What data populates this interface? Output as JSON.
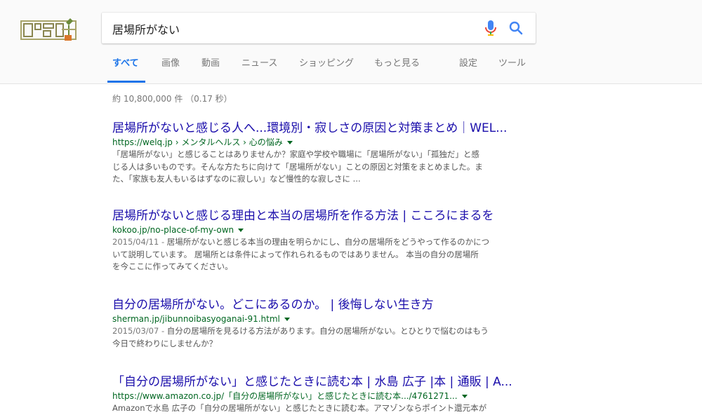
{
  "search": {
    "query": "居場所がない"
  },
  "tabs": [
    {
      "label": "すべて"
    },
    {
      "label": "画像"
    },
    {
      "label": "動画"
    },
    {
      "label": "ニュース"
    },
    {
      "label": "ショッピング"
    },
    {
      "label": "もっと見る"
    },
    {
      "label": "設定"
    },
    {
      "label": "ツール"
    }
  ],
  "stats": "約 10,800,000 件 （0.17 秒）",
  "colors": {
    "link": "#1a0dab",
    "url": "#006621",
    "accent": "#1a73e8",
    "snippet": "#545454"
  },
  "results": [
    {
      "title": "居場所がないと感じる人へ...環境別・寂しさの原因と対策まとめ｜WEL...",
      "url": "https://welq.jp › メンタルヘルス › 心の悩み",
      "snippet": [
        "「居場所がない」と感じることはありませんか？家庭や学校や職場に「居場所がない」「孤独だ」と感",
        "じる人は多いものです。そんな方たちに向けて「居場所がない」ことの原因と対策をまとめました。ま",
        "た、「家族も友人もいるはずなのに寂しい」など慢性的な寂しさに ..."
      ]
    },
    {
      "title": "居場所がないと感じる理由と本当の居場所を作る方法 | こころにまるを",
      "url": "kokoo.jp/no-place-of-my-own",
      "date": "2015/04/11 - ",
      "snippet": [
        "居場所がないと感じる本当の理由を明らかにし、自分の居場所をどうやって作るのかにつ",
        "いて説明しています。 居場所とは条件によって作れられるものではありません。 本当の自分の居場所",
        "を今ここに作ってみてください。"
      ]
    },
    {
      "title": "自分の居場所がない。どこにあるのか。 | 後悔しない生き方",
      "url": "sherman.jp/jibunnoibasyoganai-91.html",
      "date": "2015/03/07 - ",
      "snippet": [
        "自分の居場所を見るける方法があります。自分の居場所がない。とひとりで悩むのはもう",
        "今日で終わりにしませんか？"
      ]
    },
    {
      "title": "「自分の居場所がない」と感じたときに読む本 | 水島 広子 |本 | 通販 | A...",
      "url": "https://www.amazon.co.jp/「自分の居場所がない」と感じたときに読む本.../4761271...",
      "snippet": [
        "Amazonで水島 広子の「自分の居場所がない」と感じたときに読む本。アマゾンならポイント還元本が"
      ]
    }
  ]
}
